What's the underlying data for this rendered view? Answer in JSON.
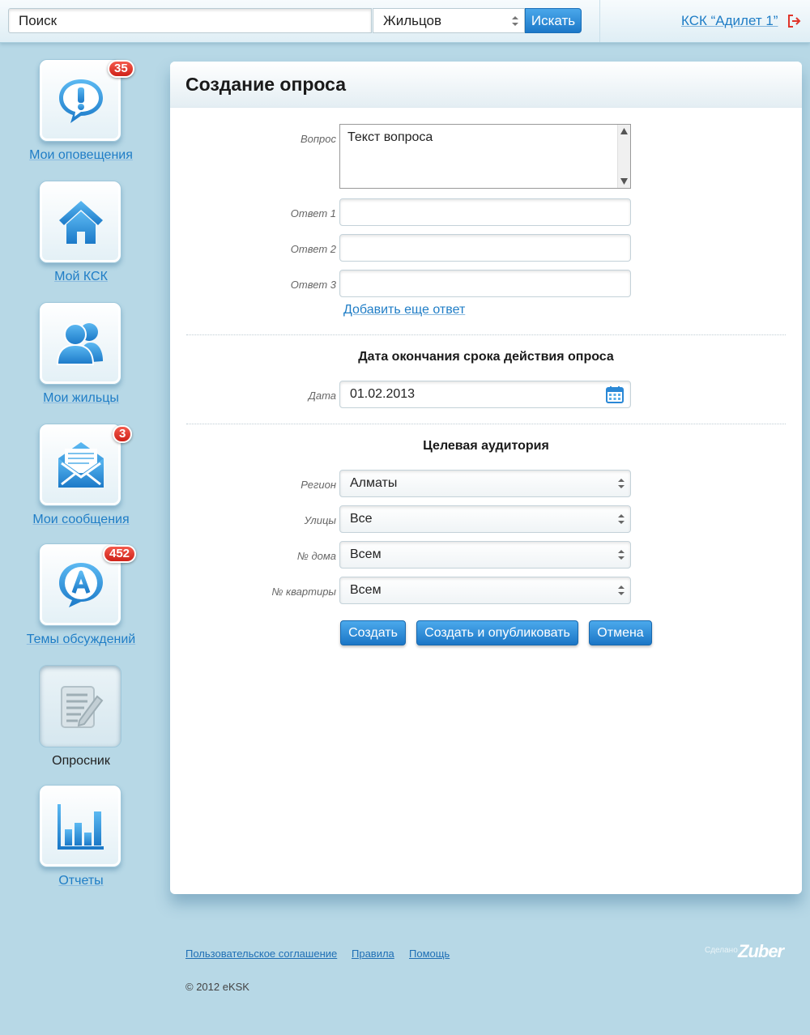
{
  "topbar": {
    "search_value": "Поиск",
    "search_scope": "Жильцов",
    "search_button": "Искать",
    "ksk_link": "КСК “Адилет 1”"
  },
  "sidebar": {
    "items": [
      {
        "label": "Мои оповещения",
        "icon": "alert-bubble-icon",
        "badge": "35"
      },
      {
        "label": "Мой КСК",
        "icon": "home-icon"
      },
      {
        "label": "Мои жильцы",
        "icon": "users-icon"
      },
      {
        "label": "Мои сообщения",
        "icon": "envelope-icon",
        "badge": "3"
      },
      {
        "label": "Темы обсуждений",
        "icon": "discussion-bubble-icon",
        "badge": "452"
      },
      {
        "label": "Опросник",
        "icon": "survey-icon",
        "active": true
      },
      {
        "label": "Отчеты",
        "icon": "bar-chart-icon"
      }
    ]
  },
  "form": {
    "title": "Создание опроса",
    "question_label": "Вопрос",
    "question_value": "Текст вопроса",
    "answer1_label": "Ответ 1",
    "answer2_label": "Ответ 2",
    "answer3_label": "Ответ 3",
    "answer1_value": "",
    "answer2_value": "",
    "answer3_value": "",
    "add_answer_link": "Добавить еще ответ",
    "deadline_title": "Дата окончания срока действия опроса",
    "date_label": "Дата",
    "date_value": "01.02.2013",
    "audience_title": "Целевая аудитория",
    "region_label": "Регион",
    "region_value": "Алматы",
    "streets_label": "Улицы",
    "streets_value": "Все",
    "house_label": "№ дома",
    "house_value": "Всем",
    "apartment_label": "№ квартиры",
    "apartment_value": "Всем",
    "create_button": "Создать",
    "create_publish_button": "Создать и опубликовать",
    "cancel_button": "Отмена"
  },
  "footer": {
    "agreement": "Пользовательское соглашение",
    "rules": "Правила",
    "help": "Помощь",
    "copyright": "© 2012 eKSK",
    "made_by": "Сделано",
    "made_by_brand": "Zuber"
  },
  "colors": {
    "accent": "#1f7dc6",
    "button": "#2a88d6",
    "badge": "#e0352a",
    "background": "#b7d8e6"
  }
}
